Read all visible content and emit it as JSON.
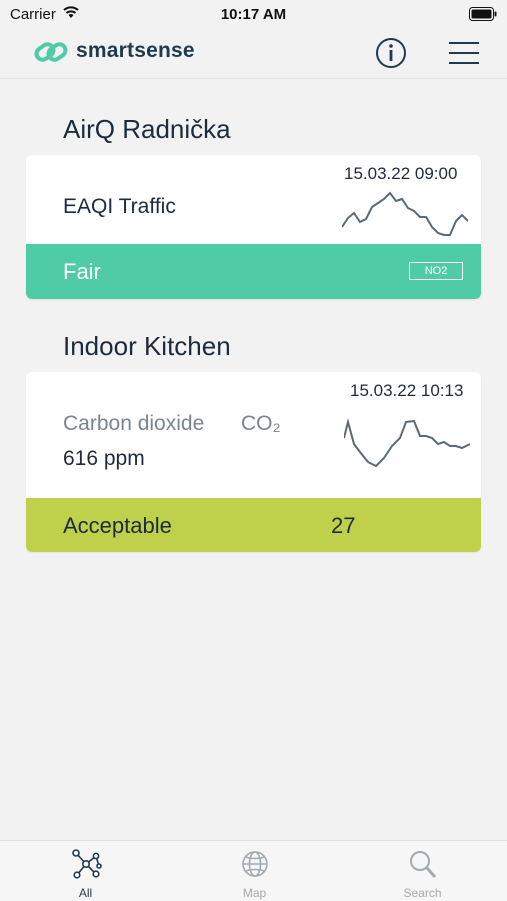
{
  "status_bar": {
    "carrier": "Carrier",
    "time": "10:17 AM"
  },
  "header": {
    "brand": "smartsense"
  },
  "sections": [
    {
      "title": "AirQ Radnička",
      "timestamp": "15.03.22 09:00",
      "metric_label": "EAQI Traffic",
      "status_label": "Fair",
      "badge": "NO2",
      "status_color": "#4fcba6"
    },
    {
      "title": "Indoor Kitchen",
      "timestamp": "15.03.22 10:13",
      "metric_label": "Carbon dioxide",
      "metric_symbol": "CO₂",
      "metric_value": "616 ppm",
      "status_label": "Acceptable",
      "status_value": "27",
      "status_color": "#bfd14a"
    }
  ],
  "tabs": [
    {
      "label": "All",
      "icon": "network-icon",
      "active": true
    },
    {
      "label": "Map",
      "icon": "globe-icon",
      "active": false
    },
    {
      "label": "Search",
      "icon": "search-icon",
      "active": false
    }
  ]
}
